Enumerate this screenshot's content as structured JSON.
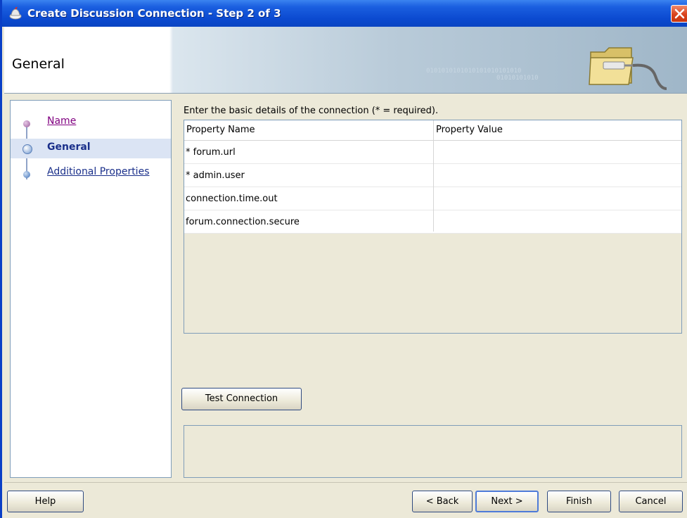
{
  "window": {
    "title": "Create Discussion Connection - Step 2 of 3",
    "close_icon": "close-icon"
  },
  "header": {
    "page_title": "General",
    "banner_binary": "0101010101010101010101010",
    "banner_binary2": "01010101010",
    "banner_icon": "folder-connection-icon"
  },
  "nav": {
    "items": [
      {
        "label": "Name",
        "state": "visited"
      },
      {
        "label": "General",
        "state": "current"
      },
      {
        "label": "Additional Properties",
        "state": "link"
      }
    ]
  },
  "main": {
    "instructions": "Enter the basic details of the connection (* = required).",
    "table": {
      "columns": [
        "Property Name",
        "Property Value"
      ],
      "rows": [
        {
          "name": "* forum.url",
          "value": ""
        },
        {
          "name": "* admin.user",
          "value": ""
        },
        {
          "name": "connection.time.out",
          "value": ""
        },
        {
          "name": "forum.connection.secure",
          "value": ""
        }
      ]
    },
    "test_connection_label": "Test Connection",
    "test_connection_mnemonic": "T"
  },
  "buttons": {
    "help": "Help",
    "back": "< Back",
    "next": "Next >",
    "finish": "Finish",
    "cancel": "Cancel"
  },
  "colors": {
    "titlebar": "#0b4ad0",
    "nav_link": "#1a2f8a",
    "nav_visited": "#800080",
    "close_button": "#d9421c"
  }
}
